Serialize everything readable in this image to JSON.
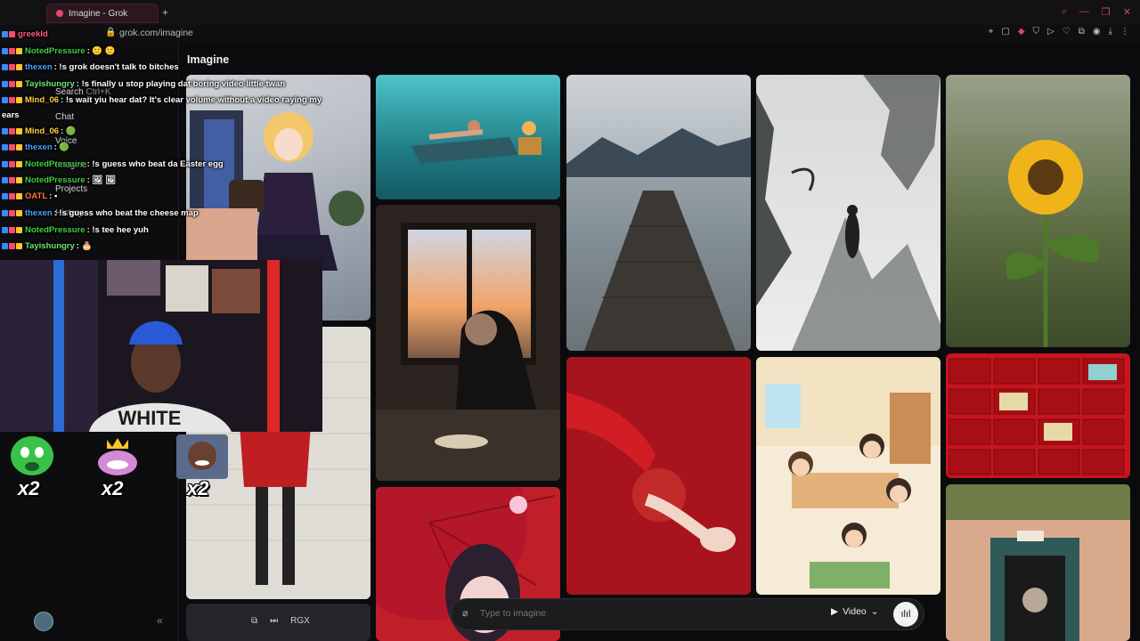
{
  "browser": {
    "tab_title": "Imagine - Grok",
    "new_tab": "+",
    "url": "grok.com/imagine"
  },
  "sidebar": {
    "search_label": "Search",
    "search_shortcut": "Ctrl+K",
    "items": [
      "Chat",
      "Voice",
      "Imagine",
      "Projects",
      "History"
    ]
  },
  "main": {
    "title": "Imagine",
    "prompt_placeholder": "Type to imagine",
    "mode_label": "Video",
    "bottom_label": "RGX"
  },
  "chat": {
    "messages": [
      {
        "user": "NotedPressure",
        "color": "#3fd13f",
        "text": ": 🙂 🙂"
      },
      {
        "user": "thexen",
        "color": "#4aa3ff",
        "text": ": !s grok doesn't talk to bitches"
      },
      {
        "user": "Tayishungry",
        "color": "#6ee86e",
        "text": ": !s finally u stop playing dat boring video little twan"
      },
      {
        "user": "Mind_06",
        "color": "#ffd23f",
        "text": ": !s wait yiu hear dat? It's clear volume without a video raying my"
      },
      {
        "user": "",
        "color": "#ffffff",
        "text": "ears"
      },
      {
        "user": "Mind_06",
        "color": "#ffd23f",
        "text": ": 🟢"
      },
      {
        "user": "thexen",
        "color": "#4aa3ff",
        "text": ": 🟢"
      },
      {
        "user": "NotedPressure",
        "color": "#3fd13f",
        "text": ": !s guess who beat da Easter egg"
      },
      {
        "user": "NotedPressure",
        "color": "#3fd13f",
        "text": ": 🖼 🖼"
      },
      {
        "user": "OATL",
        "color": "#ff7a2f",
        "text": ": ▪"
      },
      {
        "user": "thexen",
        "color": "#4aa3ff",
        "text": ": !s guess who beat the cheese map"
      },
      {
        "user": "NotedPressure",
        "color": "#3fd13f",
        "text": ": !s tee hee yuh"
      },
      {
        "user": "Tayishungry",
        "color": "#6ee86e",
        "text": ": 🎂"
      }
    ],
    "top_partial": "greekId"
  },
  "overlay": {
    "emote_count_1": "x2",
    "emote_count_2": "x2",
    "emote_count_3": "x2",
    "shirt_text": "WHITE"
  }
}
